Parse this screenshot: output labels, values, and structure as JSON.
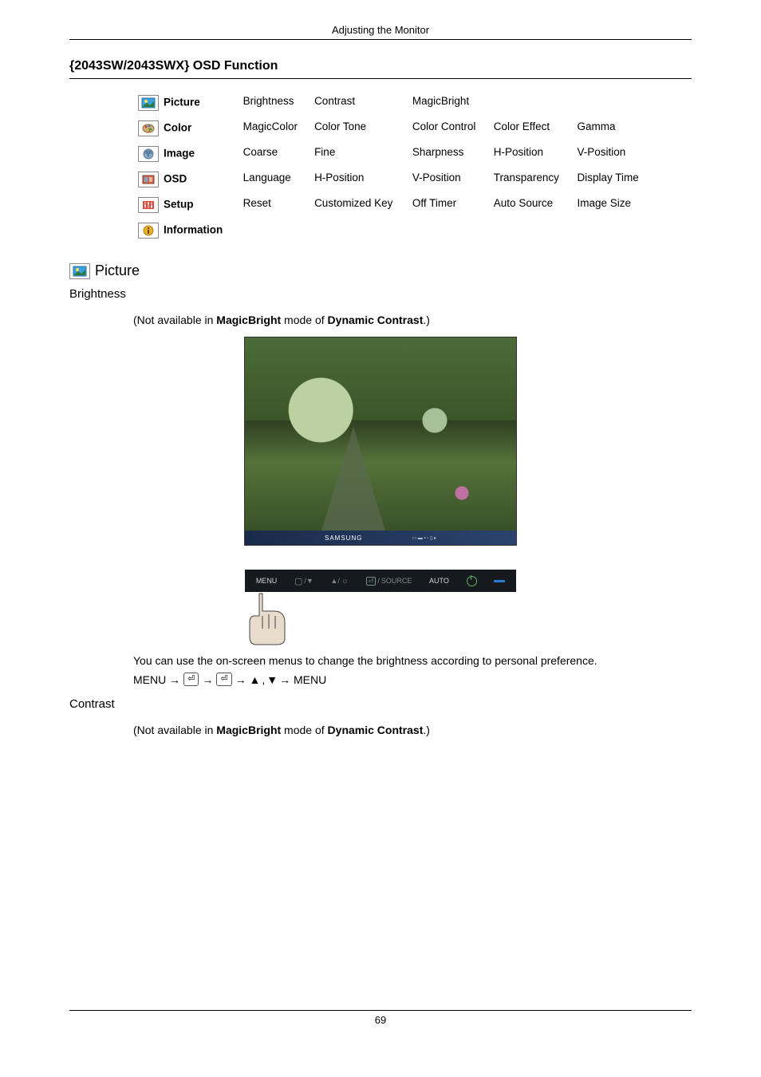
{
  "page": {
    "header": "Adjusting the Monitor",
    "number": "69"
  },
  "main_heading": "{2043SW/2043SWX} OSD Function",
  "menu": [
    {
      "label": "Picture",
      "cells": [
        "Brightness",
        "Contrast",
        "MagicBright",
        "",
        ""
      ]
    },
    {
      "label": "Color",
      "cells": [
        "MagicColor",
        "Color Tone",
        "Color Control",
        "Color Effect",
        "Gamma"
      ]
    },
    {
      "label": "Image",
      "cells": [
        "Coarse",
        "Fine",
        "Sharpness",
        "H-Position",
        "V-Position"
      ]
    },
    {
      "label": "OSD",
      "cells": [
        "Language",
        "H-Position",
        "V-Position",
        "Transparency",
        "Display Time"
      ]
    },
    {
      "label": "Setup",
      "cells": [
        "Reset",
        "Customized Key",
        "Off Timer",
        "Auto Source",
        "Image Size"
      ]
    },
    {
      "label": "Information",
      "cells": [
        "",
        "",
        "",
        "",
        ""
      ]
    }
  ],
  "picture": {
    "heading": "Picture",
    "brightness": {
      "title": "Brightness",
      "note_pre": "(Not available in ",
      "note_b1": "MagicBright",
      "note_mid": "  mode of ",
      "note_b2": "Dynamic Contrast",
      "note_post": ".)",
      "photo_brand": "SAMSUNG",
      "btnbar": {
        "menu": "MENU",
        "source": "SOURCE",
        "auto": "AUTO"
      },
      "desc": "You can use the on-screen menus to change the brightness according to personal preference.",
      "menuline": {
        "menu1": "MENU → ",
        "arrow": "→ ",
        "tri": " ,  ",
        "menu2": "→ MENU"
      }
    },
    "contrast": {
      "title": "Contrast",
      "note_pre": "(Not available in ",
      "note_b1": "MagicBright",
      "note_mid": " mode of ",
      "note_b2": "Dynamic Contrast",
      "note_post": ".)"
    }
  }
}
